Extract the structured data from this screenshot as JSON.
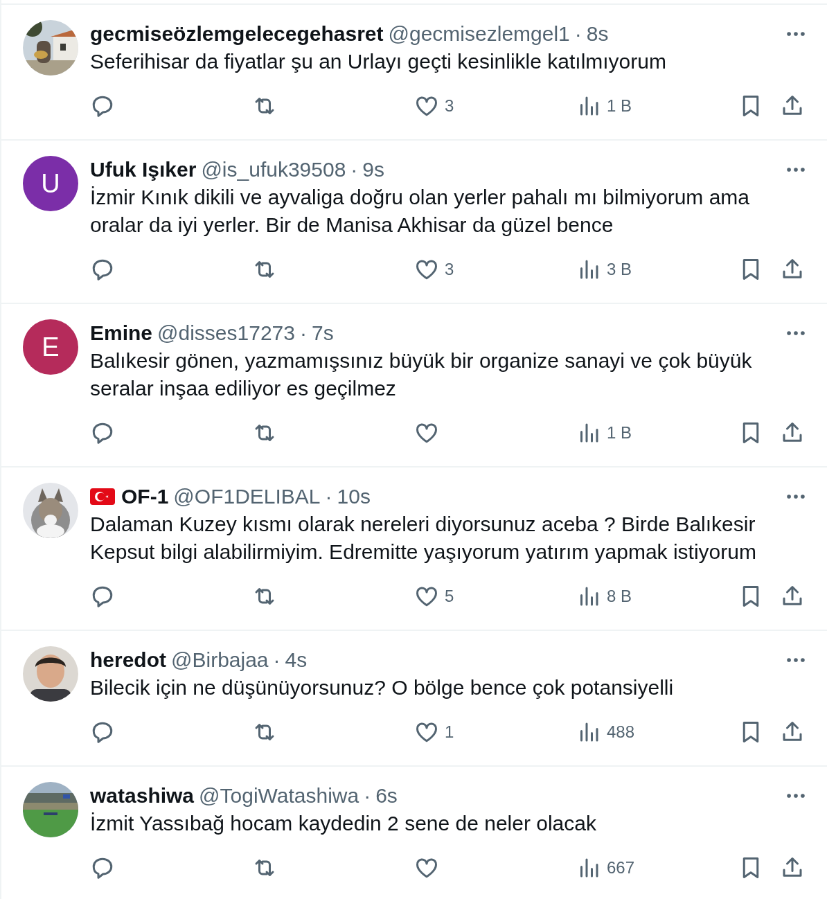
{
  "tweets": [
    {
      "author": {
        "name": "gecmiseözlemgelecegehasret",
        "handle": "@gecmisezlemgel1",
        "separator": "·",
        "time": "8s",
        "flag": false
      },
      "text": "Seferihisar da fiyatlar şu an Urlayı geçti kesinlikle katılmıyorum",
      "likes": "3",
      "views": "1 B"
    },
    {
      "author": {
        "name": "Ufuk Işıker",
        "handle": "@is_ufuk39508",
        "separator": "·",
        "time": "9s",
        "flag": false
      },
      "avatar": {
        "kind": "letter",
        "letter": "U",
        "color": "#7b2ea8"
      },
      "text": "İzmir Kınık dikili ve ayvaliga doğru olan yerler pahalı mı bilmiyorum ama oralar da iyi yerler. Bir de Manisa Akhisar da güzel bence",
      "likes": "3",
      "views": "3 B"
    },
    {
      "author": {
        "name": "Emine",
        "handle": "@disses17273",
        "separator": "·",
        "time": "7s",
        "flag": false
      },
      "avatar": {
        "kind": "letter",
        "letter": "E",
        "color": "#b52b5b"
      },
      "text": "Balıkesir gönen, yazmamışsınız  büyük bir organize sanayi ve çok büyük seralar inşaa ediliyor es geçilmez",
      "views": "1 B"
    },
    {
      "author": {
        "name": "OF-1",
        "handle": "@OF1DELIBAL",
        "separator": "·",
        "time": "10s",
        "flag": true
      },
      "text": "Dalaman Kuzey kısmı olarak nereleri diyorsunuz aceba ? Birde Balıkesir Kepsut bilgi alabilirmiyim. Edremitte yaşıyorum yatırım yapmak istiyorum",
      "likes": "5",
      "views": "8 B"
    },
    {
      "author": {
        "name": "heredot",
        "handle": "@Birbajaa",
        "separator": "·",
        "time": "4s",
        "flag": false
      },
      "text": "Bilecik için ne düşünüyorsunuz? O bölge bence çok potansiyelli",
      "likes": "1",
      "views": "488"
    },
    {
      "author": {
        "name": "watashiwa",
        "handle": "@TogiWatashiwa",
        "separator": "·",
        "time": "6s",
        "flag": false
      },
      "text": "İzmit Yassıbağ hocam kaydedin 2 sene de neler olacak",
      "views": "667"
    }
  ]
}
